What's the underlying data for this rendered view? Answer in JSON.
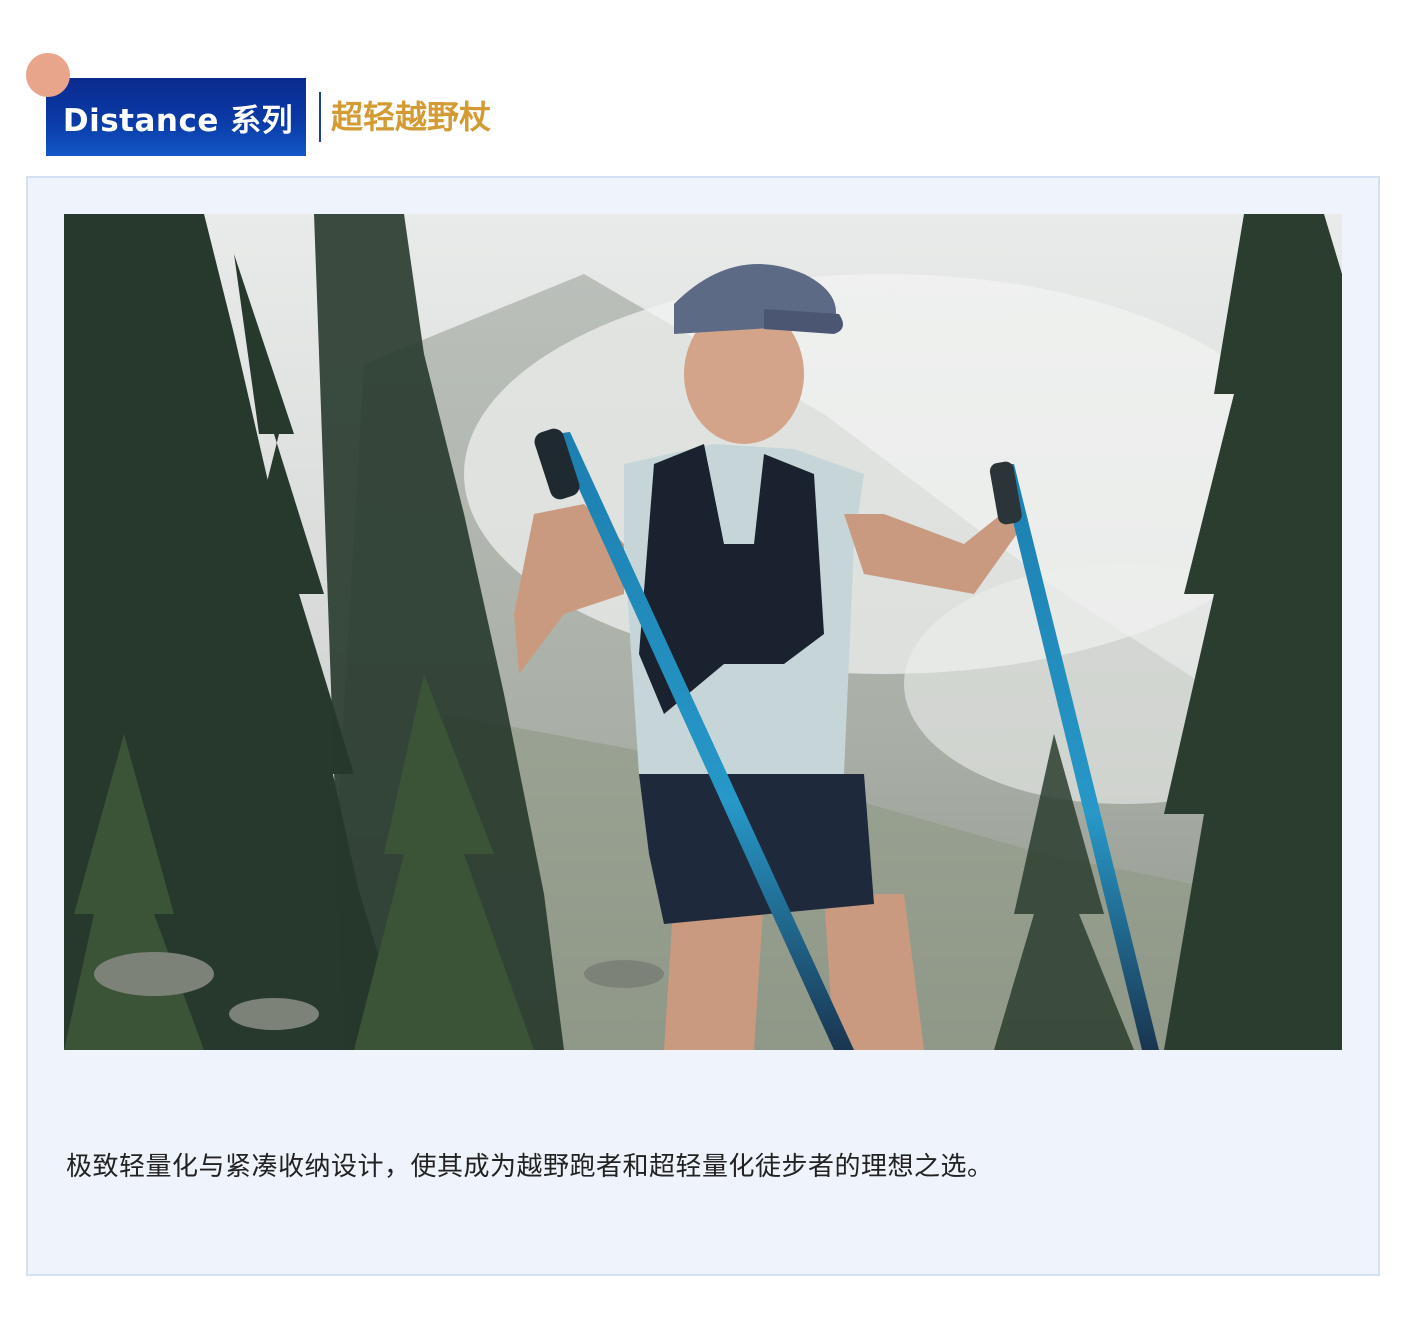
{
  "header": {
    "series_label": "Distance 系列",
    "product_title": "超轻越野杖"
  },
  "colors": {
    "badge_blue": "#0a3aa6",
    "accent_gold": "#d49b34",
    "dot_peach": "#e8a58b",
    "card_bg": "#eff3fb",
    "card_border": "#d6e0f3"
  },
  "photo": {
    "subject": "trail runner with trekking poles on a misty mountain slope among pine trees"
  },
  "caption": {
    "text": "极致轻量化与紧凑收纳设计，使其成为越野跑者和超轻量化徒步者的理想之选。"
  }
}
